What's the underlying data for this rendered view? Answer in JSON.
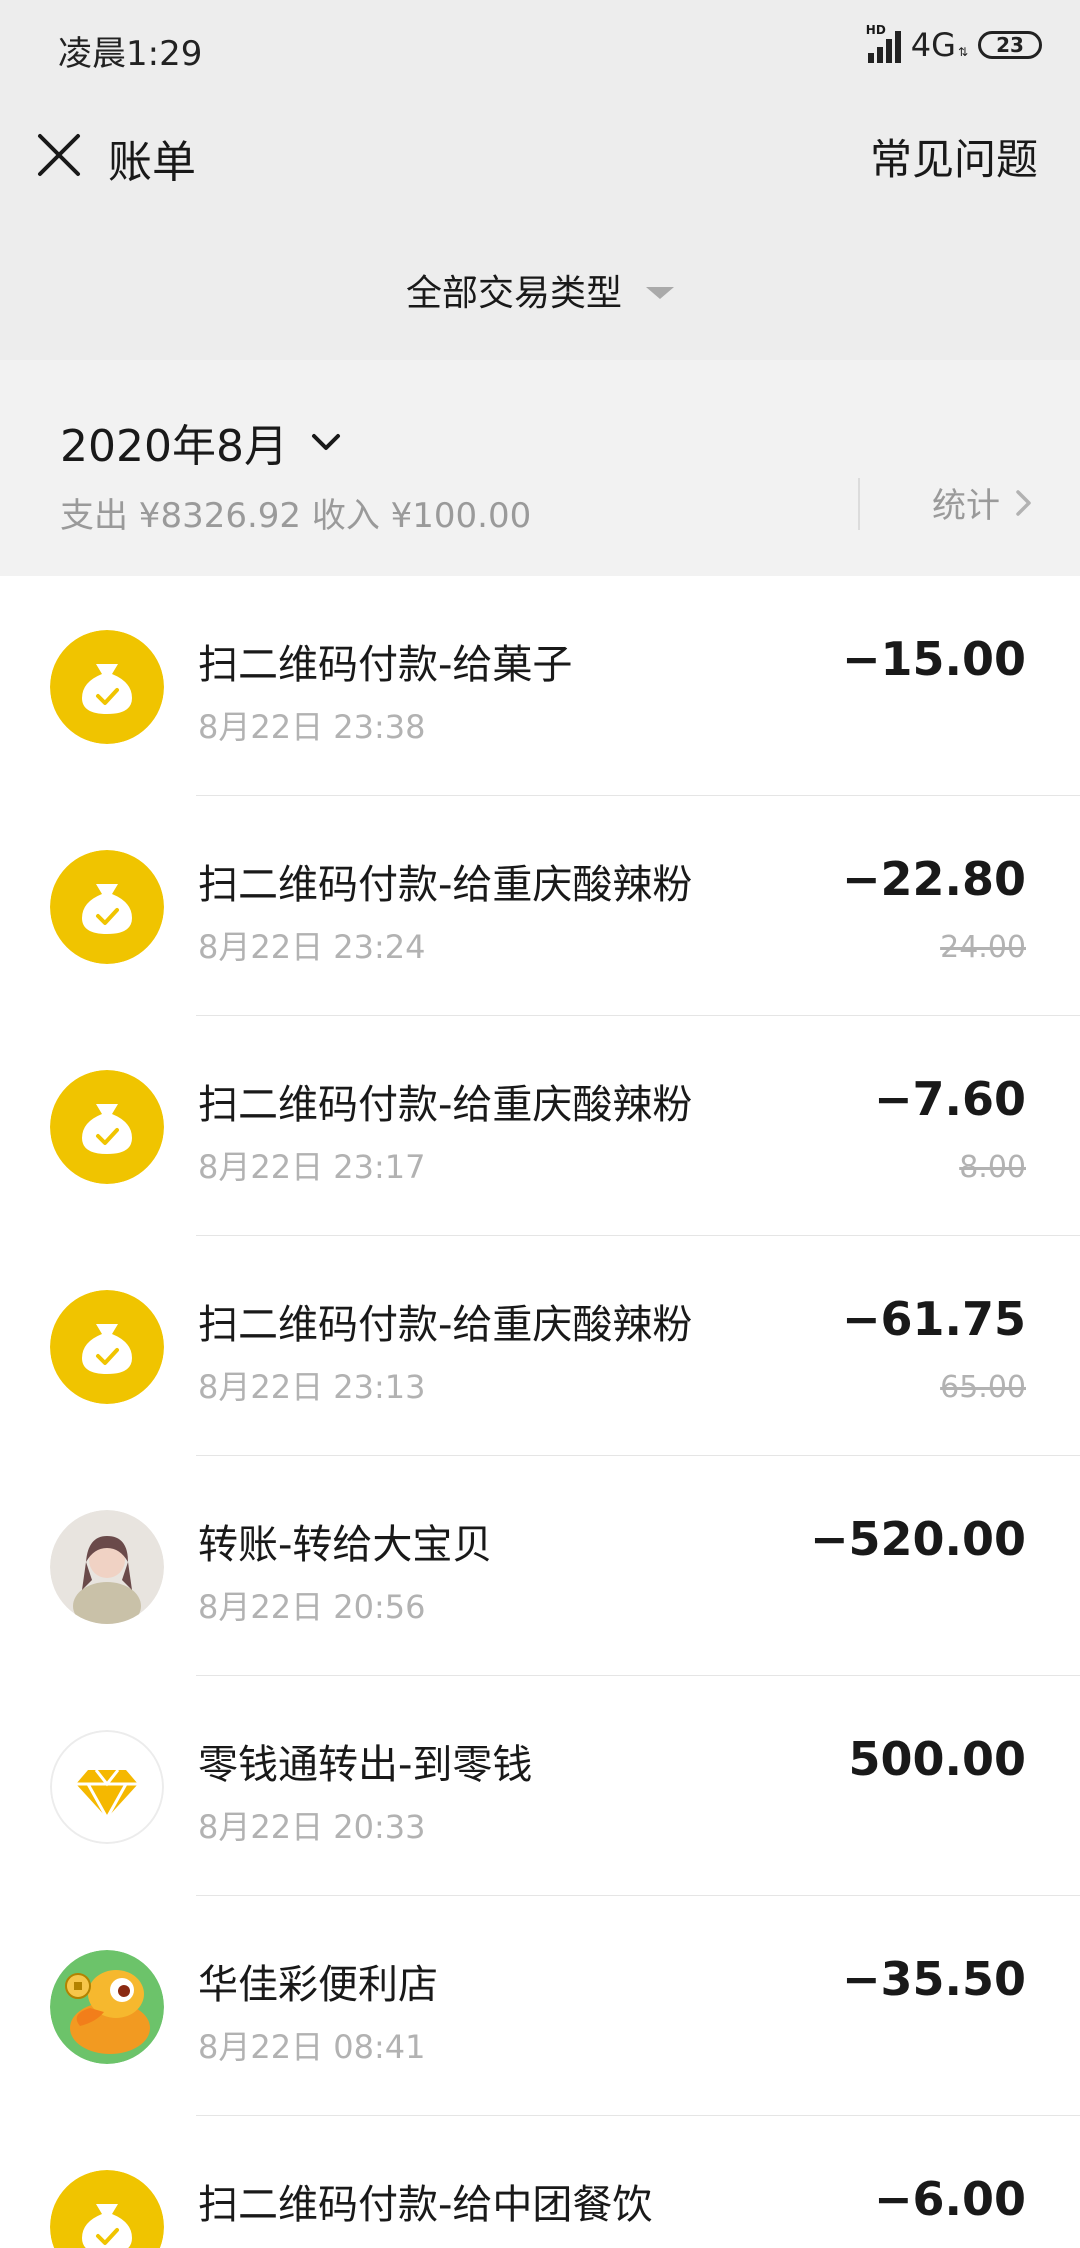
{
  "status_bar": {
    "time": "凌晨1:29",
    "network": "4G",
    "battery": "23"
  },
  "nav": {
    "title": "账单",
    "faq": "常见问题"
  },
  "filter": {
    "label": "全部交易类型"
  },
  "month": {
    "label": "2020年8月",
    "summary": "支出 ¥8326.92 收入 ¥100.00",
    "stats": "统计"
  },
  "colors": {
    "yellow": "#f0c400",
    "bg": "#ededed",
    "muted": "#b2b2b2"
  },
  "transactions": [
    {
      "icon": "money-bag-icon",
      "title": "扫二维码付款-给菓子",
      "time": "8月22日 23:38",
      "amount": "−15.00",
      "original": ""
    },
    {
      "icon": "money-bag-icon",
      "title": "扫二维码付款-给重庆酸辣粉",
      "time": "8月22日 23:24",
      "amount": "−22.80",
      "original": "24.00"
    },
    {
      "icon": "money-bag-icon",
      "title": "扫二维码付款-给重庆酸辣粉",
      "time": "8月22日 23:17",
      "amount": "−7.60",
      "original": "8.00"
    },
    {
      "icon": "money-bag-icon",
      "title": "扫二维码付款-给重庆酸辣粉",
      "time": "8月22日 23:13",
      "amount": "−61.75",
      "original": "65.00"
    },
    {
      "icon": "user-avatar",
      "title": "转账-转给大宝贝",
      "time": "8月22日 20:56",
      "amount": "−520.00",
      "original": ""
    },
    {
      "icon": "diamond-icon",
      "title": "零钱通转出-到零钱",
      "time": "8月22日 20:33",
      "amount": "500.00",
      "original": ""
    },
    {
      "icon": "duck-avatar",
      "title": "华佳彩便利店",
      "time": "8月22日 08:41",
      "amount": "−35.50",
      "original": ""
    },
    {
      "icon": "money-bag-icon",
      "title": "扫二维码付款-给中团餐饮",
      "time": "",
      "amount": "−6.00",
      "original": ""
    }
  ]
}
